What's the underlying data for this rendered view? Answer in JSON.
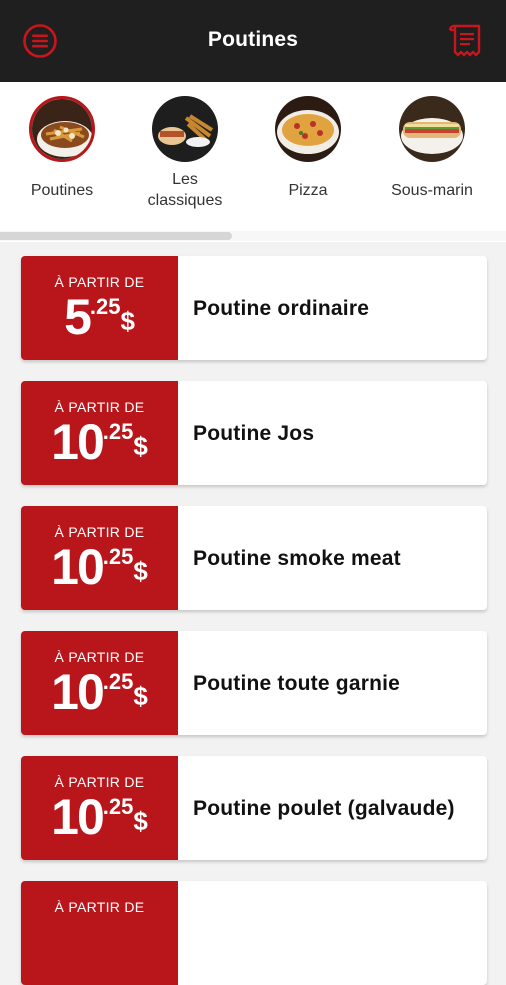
{
  "header": {
    "title": "Poutines",
    "accent": "#b8161b",
    "menu_icon": "hamburger-menu-icon",
    "receipt_icon": "receipt-icon"
  },
  "categories": [
    {
      "label": "Poutines",
      "active": true
    },
    {
      "label": "Les\nclassiques",
      "active": false
    },
    {
      "label": "Pizza",
      "active": false
    },
    {
      "label": "Sous-marin",
      "active": false
    }
  ],
  "products": [
    {
      "from_label": "À PARTIR DE",
      "price_int": "5",
      "price_cents": ".25",
      "currency": "$",
      "name": "Poutine ordinaire"
    },
    {
      "from_label": "À PARTIR DE",
      "price_int": "10",
      "price_cents": ".25",
      "currency": "$",
      "name": "Poutine Jos"
    },
    {
      "from_label": "À PARTIR DE",
      "price_int": "10",
      "price_cents": ".25",
      "currency": "$",
      "name": "Poutine smoke meat"
    },
    {
      "from_label": "À PARTIR DE",
      "price_int": "10",
      "price_cents": ".25",
      "currency": "$",
      "name": "Poutine toute garnie"
    },
    {
      "from_label": "À PARTIR DE",
      "price_int": "10",
      "price_cents": ".25",
      "currency": "$",
      "name": "Poutine poulet (galvaude)"
    },
    {
      "from_label": "À PARTIR DE",
      "price_int": "",
      "price_cents": "",
      "currency": "",
      "name": ""
    }
  ]
}
